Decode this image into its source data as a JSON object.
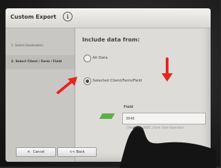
{
  "window": {
    "title": "Custom Export",
    "info_glyph": "i"
  },
  "sidebar": {
    "steps": [
      {
        "label": "1. Select Destination"
      },
      {
        "label": "2. Select Client / Farm / Field"
      },
      {
        "label": ""
      }
    ]
  },
  "main": {
    "heading": "Include data from:",
    "options": [
      {
        "label": "All Data",
        "selected": false
      },
      {
        "label": "Selected Client/Farm/Field",
        "selected": true
      }
    ],
    "field_label": "Field",
    "field_value": "3648",
    "field_subtext": "Client: Info. ABDC | Farm: Farm Operation"
  },
  "footer": {
    "cancel_label": "Cancel",
    "cancel_glyph": "✕",
    "back_label": "<< Back"
  },
  "colors": {
    "accent_green": "#3e9b48",
    "annotation_red": "#e8241c"
  }
}
